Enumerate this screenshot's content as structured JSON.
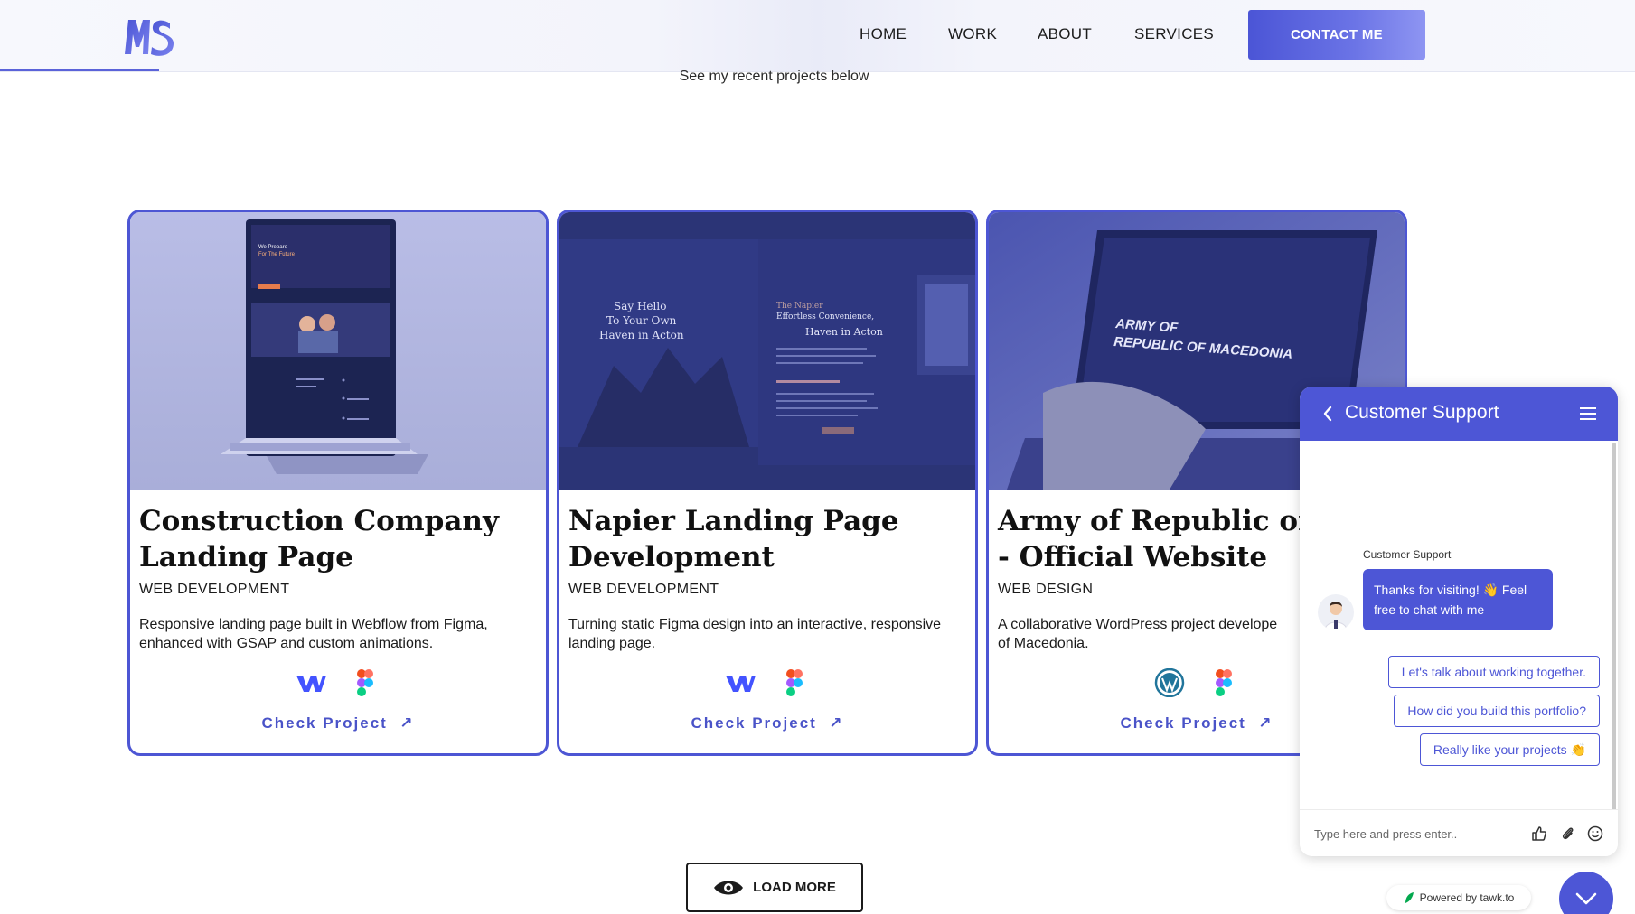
{
  "header": {
    "logo_text": "MS",
    "nav": [
      "HOME",
      "WORK",
      "ABOUT",
      "SERVICES"
    ],
    "contact_label": "CONTACT ME"
  },
  "section": {
    "subtitle": "See my recent projects below"
  },
  "projects": [
    {
      "title_line1": "Construction Company",
      "title_line2": "Landing Page",
      "category": "WEB DEVELOPMENT",
      "desc_line1": "Responsive landing page built in Webflow from Figma,",
      "desc_line2": "enhanced with GSAP and custom animations.",
      "tools": [
        "webflow-icon",
        "figma-icon"
      ],
      "link_label": "Check Project"
    },
    {
      "title_line1": "Napier Landing Page",
      "title_line2": "Development",
      "category": "WEB DEVELOPMENT",
      "desc_line1": "Turning static Figma design into an interactive, responsive",
      "desc_line2": "landing page.",
      "tools": [
        "webflow-icon",
        "figma-icon"
      ],
      "link_label": "Check Project"
    },
    {
      "title_line1": "Army of Republic of Ma",
      "title_line2": "- Official Website",
      "category": "WEB DESIGN",
      "desc_line1": "A collaborative WordPress project develope",
      "desc_line2": "of Macedonia.",
      "tools": [
        "wordpress-icon",
        "figma-icon"
      ],
      "link_label": "Check Project"
    }
  ],
  "mockups": {
    "p1_hero_line1": "We Prepare",
    "p1_hero_line2": "For The Future",
    "p2_hero_line1": "Say Hello",
    "p2_hero_line2": "To Your Own",
    "p2_hero_line3": "Haven in Acton",
    "p2_panel_line1": "The Napier",
    "p2_panel_line2": "Effortless Convenience,",
    "p2_panel_line3": "Haven in Acton",
    "p3_screen_line1": "ARMY OF",
    "p3_screen_line2": "REPUBLIC OF MACEDONIA"
  },
  "load_more_label": "LOAD MORE",
  "chat": {
    "title": "Customer Support",
    "sender": "Customer Support",
    "message": "Thanks for visiting! 👋 Feel free to chat with me",
    "quick_replies": [
      "Let's talk about working together.",
      "How did you build this portfolio?",
      "Really like your projects 👏"
    ],
    "input_placeholder": "Type here and press enter..",
    "powered_by": "Powered by tawk.to"
  },
  "colors": {
    "accent": "#4d56d6",
    "text": "#1b1b1b"
  }
}
